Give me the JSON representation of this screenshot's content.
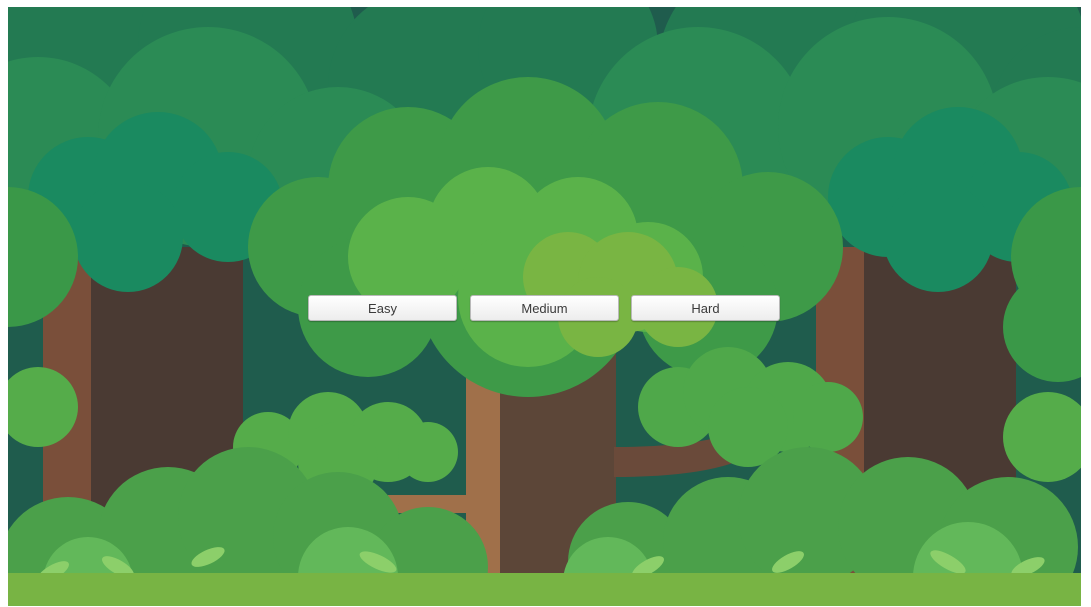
{
  "menu": {
    "buttons": [
      {
        "label": "Easy"
      },
      {
        "label": "Medium"
      },
      {
        "label": "Hard"
      }
    ]
  },
  "colors": {
    "sky_dark": "#1f5c4d",
    "canopy_far": "#2a8a55",
    "canopy_teal": "#1a8a60",
    "canopy_mid": "#3e9a48",
    "canopy_light": "#5ab24a",
    "canopy_highlight": "#79b543",
    "trunk_dark": "#4c3a32",
    "trunk_light": "#a0704a",
    "bush": "#4fa84a",
    "grass": "#78b444",
    "button_bg": "#f2f2f2",
    "button_text": "#3a3a3a"
  }
}
